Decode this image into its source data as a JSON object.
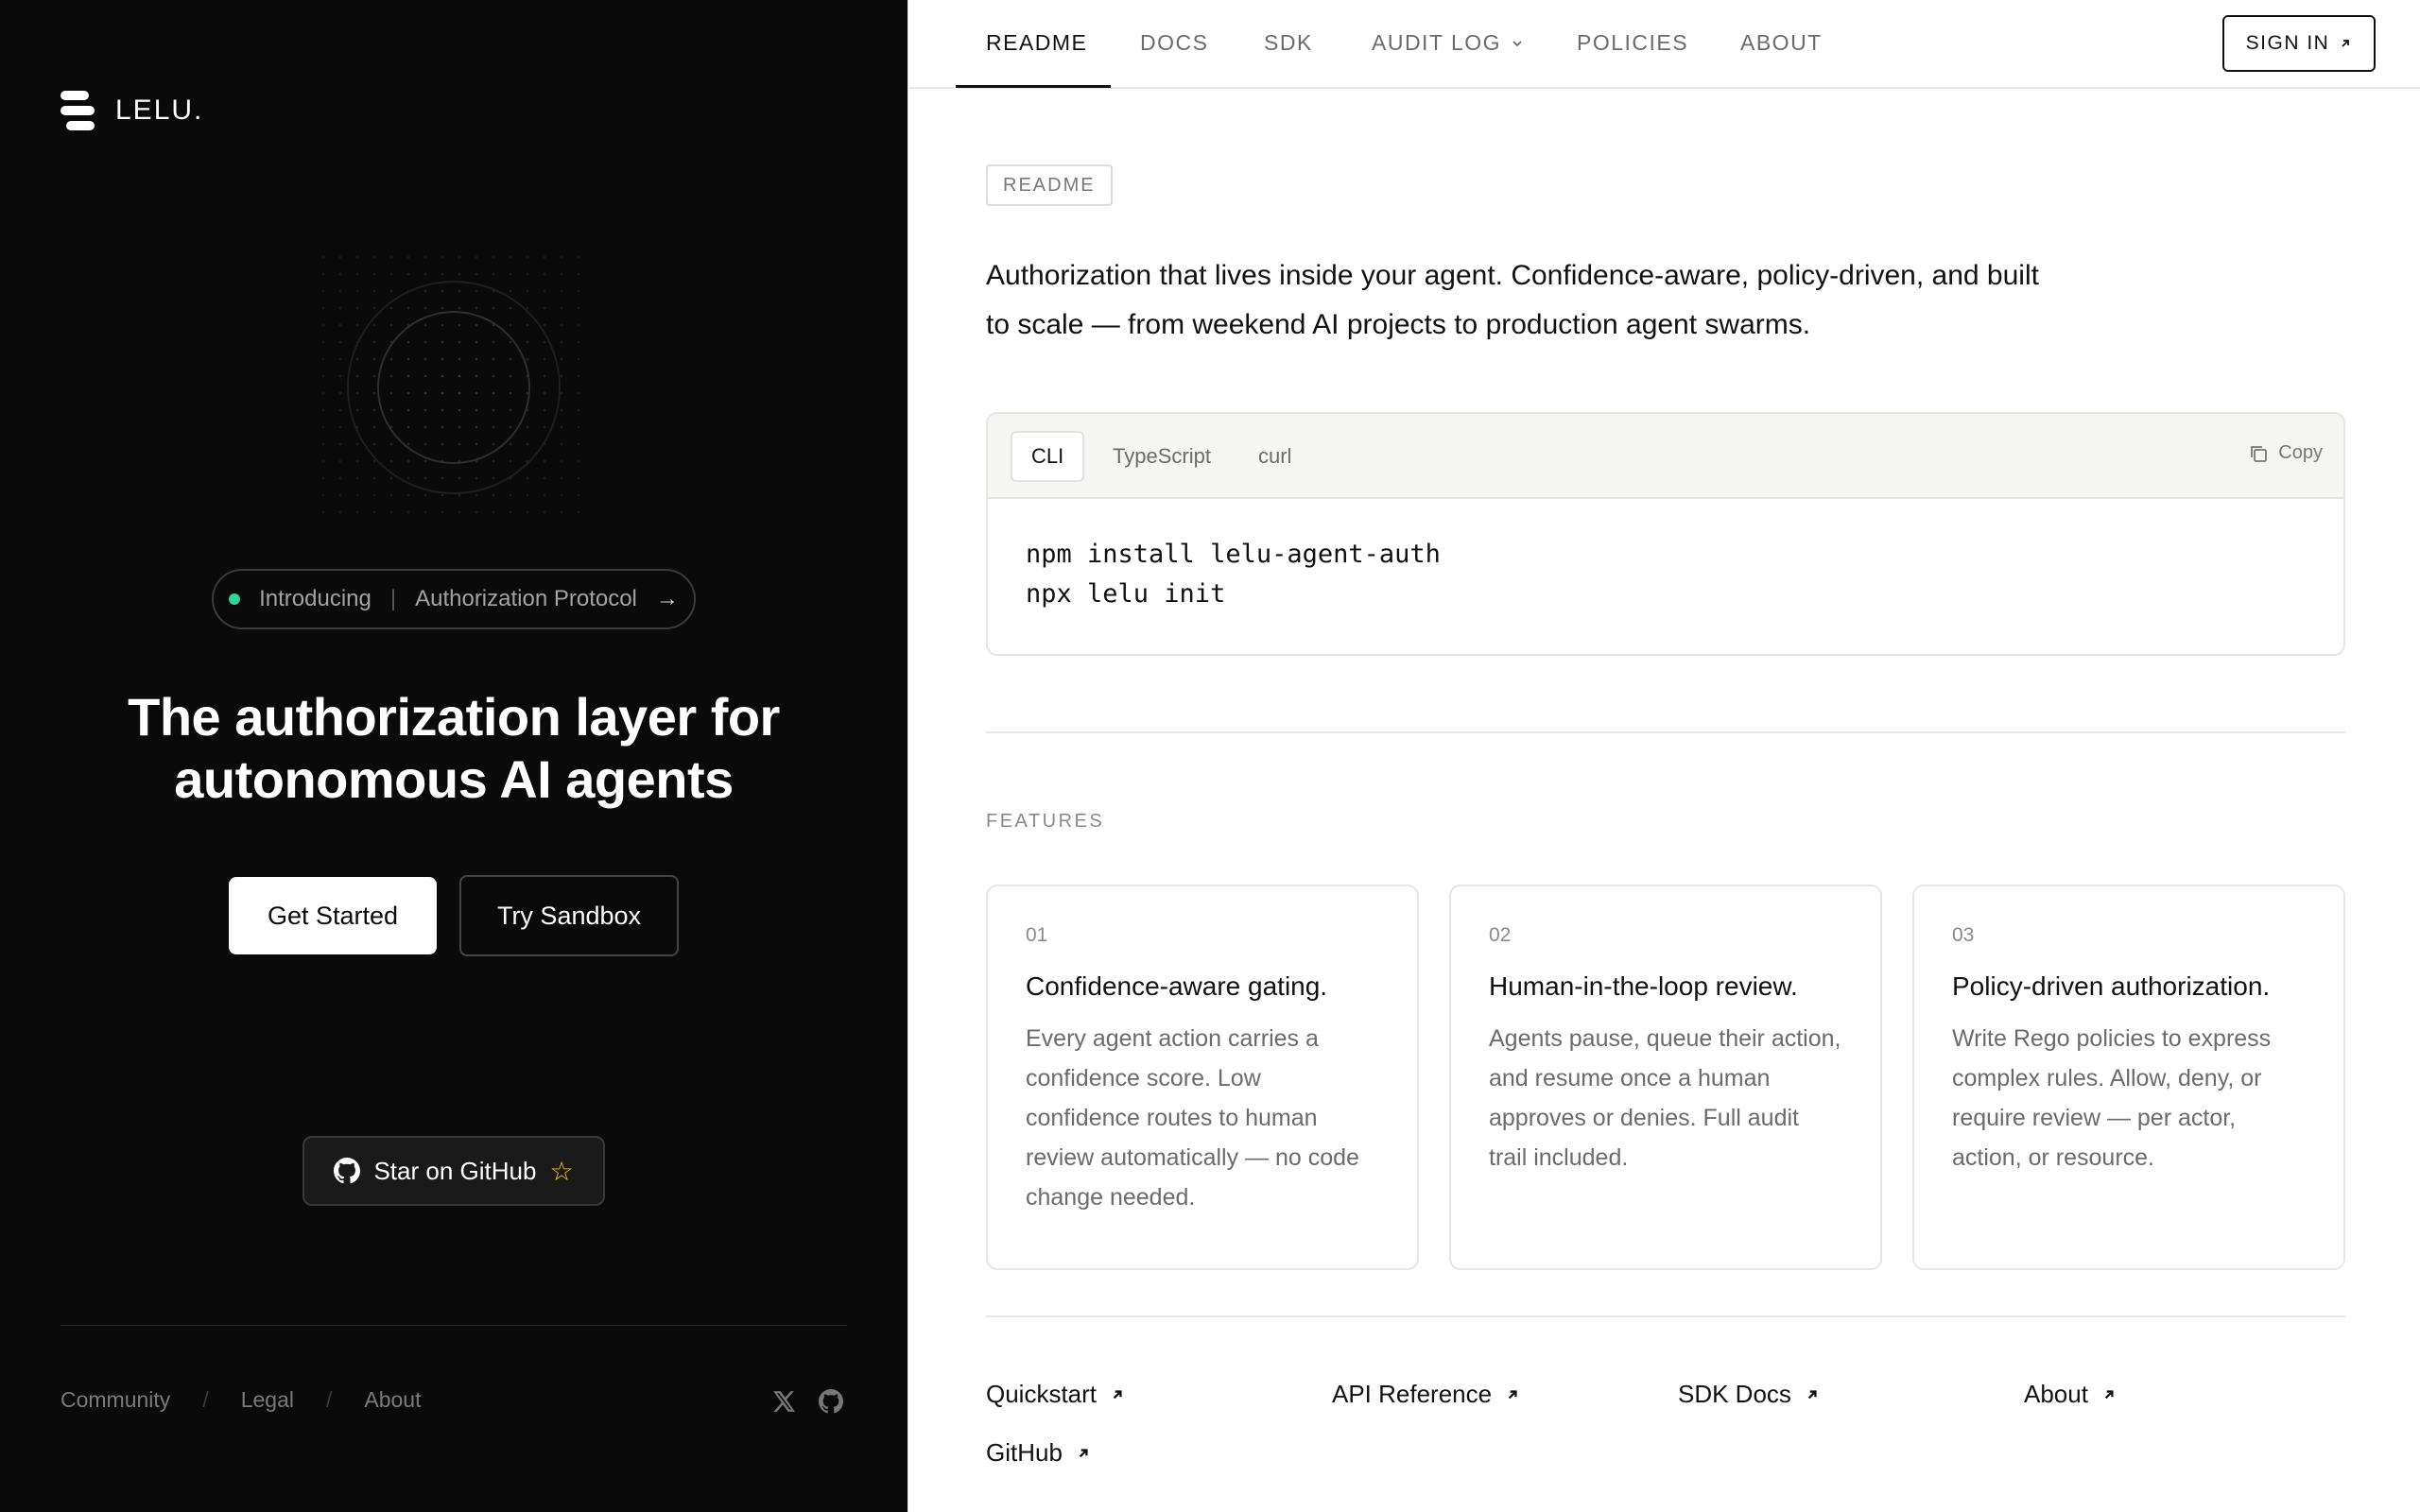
{
  "brand": {
    "name": "LELU."
  },
  "hero": {
    "pill_tag": "Introducing",
    "pill_text": "Authorization Protocol",
    "title_line1": "The authorization layer for",
    "title_line2": "autonomous AI agents",
    "primary_cta": "Get Started",
    "secondary_cta": "Try Sandbox",
    "github_cta": "Star on GitHub"
  },
  "left_footer": {
    "links": [
      "Community",
      "Legal",
      "About"
    ],
    "separator": "/"
  },
  "nav": {
    "tabs": [
      "README",
      "DOCS",
      "SDK",
      "AUDIT LOG",
      "POLICIES",
      "ABOUT"
    ],
    "active_tab": "README",
    "sign_in": "SIGN IN"
  },
  "readme": {
    "badge": "README",
    "intro_line1": "Authorization that lives inside your agent. Confidence-aware, policy-driven, and built",
    "intro_line2": "to scale — from weekend AI projects to production agent swarms."
  },
  "code": {
    "tabs": [
      "CLI",
      "TypeScript",
      "curl"
    ],
    "active_tab": "CLI",
    "copy_label": "Copy",
    "lines": [
      "npm install lelu-agent-auth",
      "npx lelu init"
    ]
  },
  "features": {
    "label": "FEATURES",
    "items": [
      {
        "num": "01",
        "title": "Confidence-aware gating.",
        "desc": "Every agent action carries a confidence score. Low confidence routes to human review automatically — no code change needed."
      },
      {
        "num": "02",
        "title": "Human-in-the-loop review.",
        "desc": "Agents pause, queue their action, and resume once a human approves or denies. Full audit trail included."
      },
      {
        "num": "03",
        "title": "Policy-driven authorization.",
        "desc": "Write Rego policies to express complex rules. Allow, deny, or require review — per actor, action, or resource."
      }
    ]
  },
  "footer_links": [
    "Quickstart",
    "API Reference",
    "SDK Docs",
    "About",
    "GitHub"
  ],
  "colors": {
    "accent_green": "#34d399",
    "star_yellow": "#facc15",
    "dark_bg": "#0a0a0a"
  }
}
